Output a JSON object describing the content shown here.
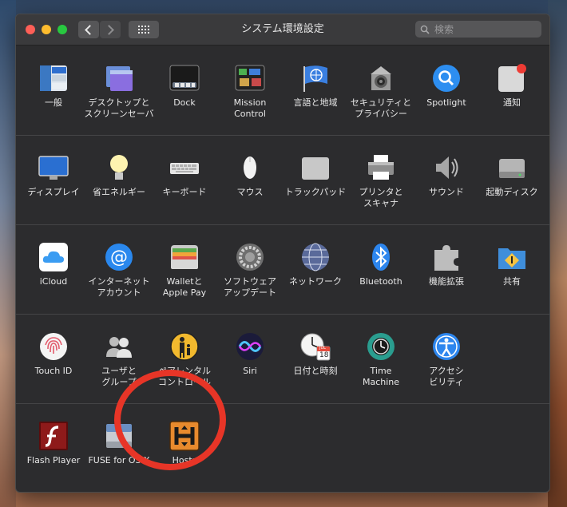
{
  "window": {
    "title": "システム環境設定",
    "search_placeholder": "検索"
  },
  "rows": [
    [
      {
        "label": "一般",
        "icon": "general-icon"
      },
      {
        "label": "デスクトップと\nスクリーンセーバ",
        "icon": "desktop-screensaver-icon"
      },
      {
        "label": "Dock",
        "icon": "dock-icon"
      },
      {
        "label": "Mission\nControl",
        "icon": "mission-control-icon"
      },
      {
        "label": "言語と地域",
        "icon": "language-region-icon"
      },
      {
        "label": "セキュリティと\nプライバシー",
        "icon": "security-privacy-icon"
      },
      {
        "label": "Spotlight",
        "icon": "spotlight-icon"
      },
      {
        "label": "通知",
        "icon": "notifications-icon"
      }
    ],
    [
      {
        "label": "ディスプレイ",
        "icon": "display-icon"
      },
      {
        "label": "省エネルギー",
        "icon": "energy-saver-icon"
      },
      {
        "label": "キーボード",
        "icon": "keyboard-icon"
      },
      {
        "label": "マウス",
        "icon": "mouse-icon"
      },
      {
        "label": "トラックパッド",
        "icon": "trackpad-icon"
      },
      {
        "label": "プリンタと\nスキャナ",
        "icon": "printer-scanner-icon"
      },
      {
        "label": "サウンド",
        "icon": "sound-icon"
      },
      {
        "label": "起動ディスク",
        "icon": "startup-disk-icon"
      }
    ],
    [
      {
        "label": "iCloud",
        "icon": "icloud-icon"
      },
      {
        "label": "インターネット\nアカウント",
        "icon": "internet-accounts-icon"
      },
      {
        "label": "Walletと\nApple Pay",
        "icon": "wallet-icon"
      },
      {
        "label": "ソフトウェア\nアップデート",
        "icon": "software-update-icon"
      },
      {
        "label": "ネットワーク",
        "icon": "network-icon"
      },
      {
        "label": "Bluetooth",
        "icon": "bluetooth-icon"
      },
      {
        "label": "機能拡張",
        "icon": "extensions-icon"
      },
      {
        "label": "共有",
        "icon": "sharing-icon"
      }
    ],
    [
      {
        "label": "Touch ID",
        "icon": "touch-id-icon"
      },
      {
        "label": "ユーザと\nグループ",
        "icon": "users-groups-icon"
      },
      {
        "label": "ペアレンタル\nコントロール",
        "icon": "parental-controls-icon"
      },
      {
        "label": "Siri",
        "icon": "siri-icon"
      },
      {
        "label": "日付と時刻",
        "icon": "date-time-icon"
      },
      {
        "label": "Time\nMachine",
        "icon": "time-machine-icon"
      },
      {
        "label": "アクセシ\nビリティ",
        "icon": "accessibility-icon"
      }
    ],
    [
      {
        "label": "Flash Player",
        "icon": "flash-player-icon"
      },
      {
        "label": "FUSE for OS X",
        "icon": "fuse-icon"
      },
      {
        "label": "Hosts",
        "icon": "hosts-icon"
      }
    ]
  ],
  "calendar": {
    "month": "JUL",
    "day": "18"
  },
  "annotation_color": "#e73527"
}
